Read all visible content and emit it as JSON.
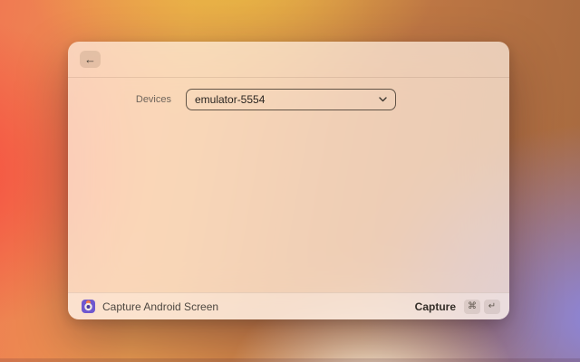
{
  "window": {
    "header": {
      "back_button": {
        "icon": "←"
      }
    },
    "form": {
      "devices": {
        "label": "Devices",
        "value": "emulator-5554"
      }
    },
    "footer": {
      "title": "Capture Android Screen",
      "action": {
        "label": "Capture",
        "shortcut": [
          "⌘",
          "↵"
        ]
      }
    }
  },
  "colors": {
    "extension_icon_purple": "#6f58cf",
    "extension_icon_orange": "#ee7a4e",
    "extension_icon_center": "#4a3a9e",
    "dropdown_border": "#382f27",
    "background_gradient": [
      "#f5564b",
      "#e9bb42",
      "#a4683f",
      "#fcf0da",
      "#8c86de"
    ]
  }
}
